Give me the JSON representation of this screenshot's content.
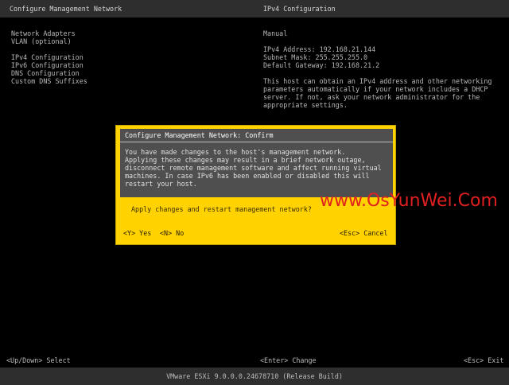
{
  "header": {
    "left_title": "Configure Management Network",
    "right_title": "IPv4 Configuration"
  },
  "menu": {
    "items": [
      "Network Adapters",
      "VLAN (optional)",
      "IPv4 Configuration",
      "IPv6 Configuration",
      "DNS Configuration",
      "Custom DNS Suffixes"
    ]
  },
  "detail": {
    "mode": "Manual",
    "ipv4_address": "IPv4 Address: 192.168.21.144",
    "subnet_mask": "Subnet Mask: 255.255.255.0",
    "default_gateway": "Default Gateway: 192.168.21.2",
    "description": "This host can obtain an IPv4 address and other networking parameters automatically if your network includes a DHCP server. If not, ask your network administrator for the appropriate settings."
  },
  "dialog": {
    "title": "Configure Management Network: Confirm",
    "message_lines": [
      "You have made changes to the host's management network.",
      "Applying these changes may result in a brief network outage,",
      "disconnect remote management software and affect running virtual",
      "machines. In case IPv6 has been enabled or disabled this will",
      "restart your host."
    ],
    "question": "Apply changes and restart management network?",
    "yes_label": "<Y> Yes",
    "no_label": "<N> No",
    "cancel_label": "<Esc> Cancel"
  },
  "bottom": {
    "select": "<Up/Down> Select",
    "change": "<Enter> Change",
    "exit": "<Esc> Exit"
  },
  "footer": {
    "version": "VMware ESXi 9.0.0.0.24678710 (Release Build)"
  },
  "watermark": "www.OsYunWei.Com",
  "colors": {
    "dialog_accent": "#ffd200",
    "dialog_body": "#4f4f4f",
    "watermark": "#e02020"
  }
}
